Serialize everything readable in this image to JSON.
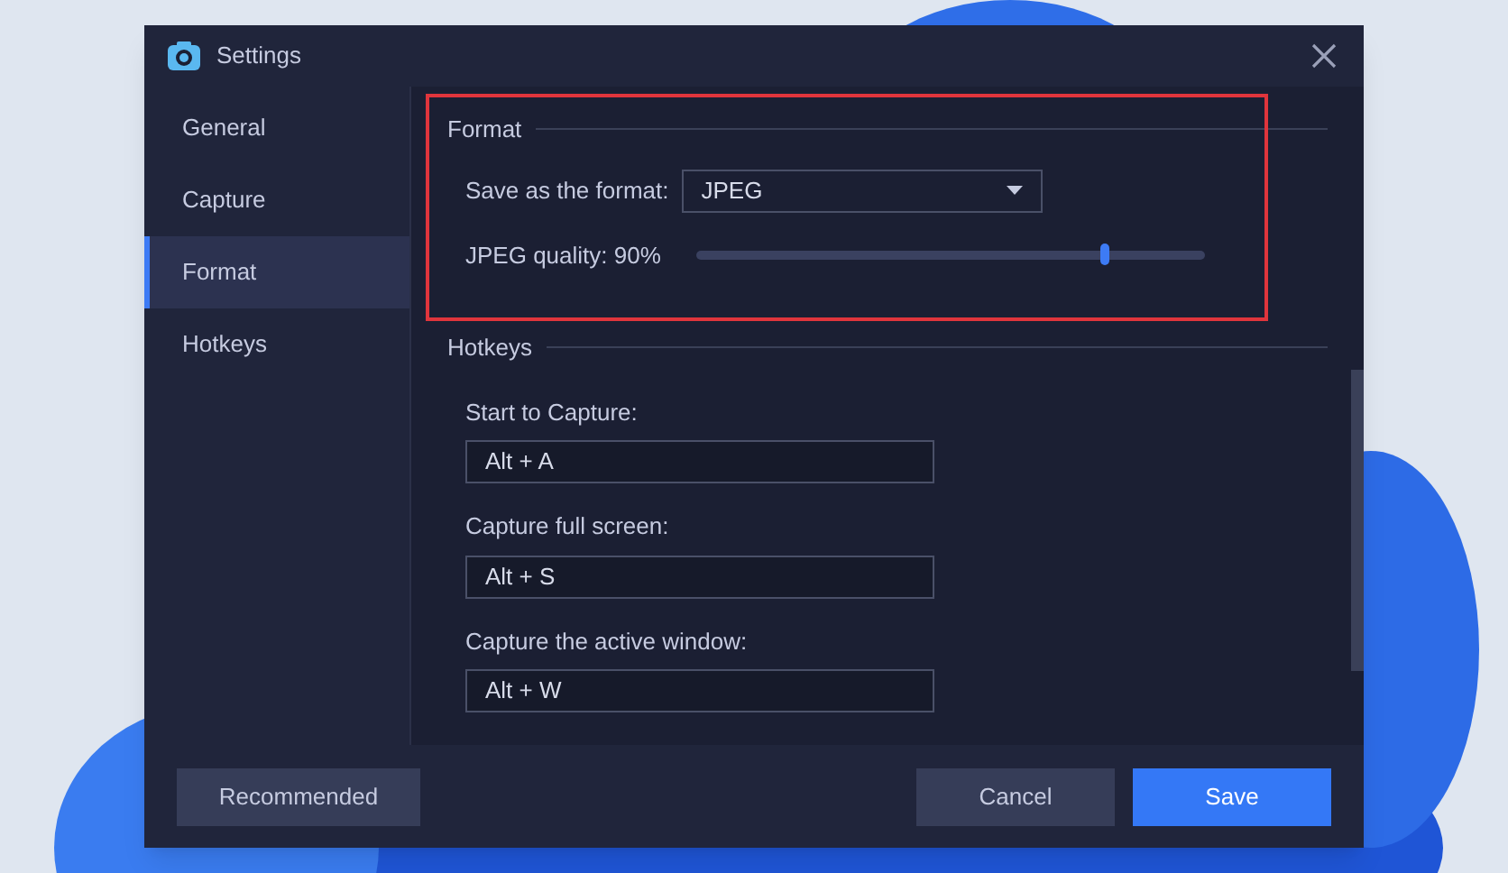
{
  "window": {
    "title": "Settings"
  },
  "sidebar": {
    "items": [
      {
        "label": "General",
        "selected": false
      },
      {
        "label": "Capture",
        "selected": false
      },
      {
        "label": "Format",
        "selected": true
      },
      {
        "label": "Hotkeys",
        "selected": false
      }
    ]
  },
  "format": {
    "heading": "Format",
    "highlighted": true,
    "save_label": "Save as the format:",
    "format_value": "JPEG",
    "quality_label": "JPEG quality: 90%",
    "level": 0.8
  },
  "hotkeys": {
    "heading": "Hotkeys",
    "items": [
      {
        "label": "Start to Capture:",
        "value": "Alt + A"
      },
      {
        "label": "Capture full screen:",
        "value": "Alt + S"
      },
      {
        "label": "Capture the active window:",
        "value": "Alt + W"
      }
    ]
  },
  "buttons": {
    "recommended": "Recommended",
    "cancel": "Cancel",
    "save": "Save"
  }
}
